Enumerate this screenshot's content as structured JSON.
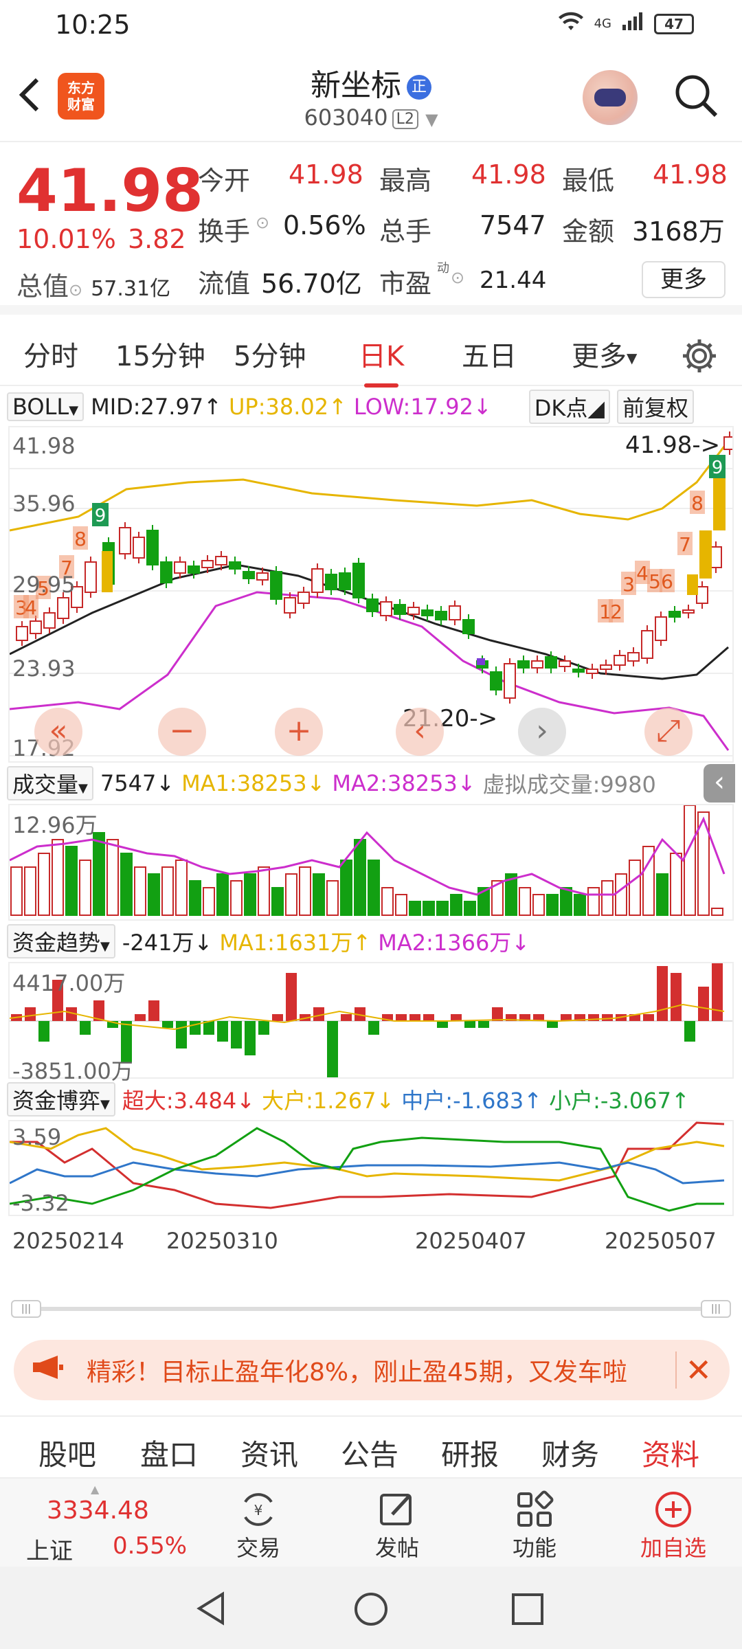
{
  "status": {
    "time": "10:25",
    "network": "4G",
    "battery": "47"
  },
  "header": {
    "name": "新坐标",
    "badge": "正",
    "code": "603040",
    "level": "L2"
  },
  "quote": {
    "price": "41.98",
    "pct": "10.01%",
    "change": "3.82",
    "total_label": "总值",
    "total_value": "57.31亿",
    "open_label": "今开",
    "open": "41.98",
    "high_label": "最高",
    "high": "41.98",
    "low_label": "最低",
    "low": "41.98",
    "turnover_label": "换手",
    "turnover": "0.56%",
    "vol_label": "总手",
    "vol": "7547",
    "amount_label": "金额",
    "amount": "3168万",
    "float_label": "流值",
    "float": "56.70亿",
    "pe_label": "市盈",
    "pe_sup": "动",
    "pe": "21.44",
    "more": "更多"
  },
  "period_tabs": [
    "分时",
    "15分钟",
    "5分钟",
    "日K",
    "五日",
    "更多"
  ],
  "boll": {
    "name": "BOLL",
    "mid": "MID:27.97",
    "up": "UP:38.02",
    "low": "LOW:17.92",
    "dk": "DK点",
    "fq": "前复权"
  },
  "kline": {
    "y_labels": [
      "41.98",
      "35.96",
      "29.95",
      "23.93",
      "17.92"
    ],
    "max_tag": "41.98->",
    "min_tag": "21.20->",
    "signals": [
      "3",
      "4",
      "5",
      "7",
      "8",
      "9",
      "12",
      "3",
      "4",
      "5",
      "6",
      "7",
      "8",
      "9"
    ]
  },
  "vol_bar": {
    "name": "成交量",
    "value": "7547",
    "ma1": "MA1:38253",
    "ma2": "MA2:38253",
    "virt": "虚拟成交量:9980",
    "max": "12.96万"
  },
  "fund_trend": {
    "name": "资金趋势",
    "value": "-241万",
    "ma1": "MA1:1631万",
    "ma2": "MA2:1366万",
    "max": "4417.00万",
    "min": "-3851.00万"
  },
  "fund_game": {
    "name": "资金博弈",
    "super": "超大:3.484",
    "big": "大户:1.267",
    "mid": "中户:-1.683",
    "small": "小户:-3.067",
    "max": "3.59",
    "min": "-3.32"
  },
  "dates": [
    "20250214",
    "20250310",
    "20250407",
    "20250507"
  ],
  "banner": {
    "text": "精彩！目标止盈年化8%，刚止盈45期，又发车啦"
  },
  "bottom_tabs": [
    "股吧",
    "盘口",
    "资讯",
    "公告",
    "研报",
    "财务",
    "资料"
  ],
  "bottom_bar": {
    "index_value": "3334.48",
    "index_name": "上证",
    "index_pct": "0.55%",
    "trade": "交易",
    "post": "发帖",
    "func": "功能",
    "add": "加自选"
  },
  "colors": {
    "up": "#e03131",
    "down": "#12a012",
    "accent": "#e03131"
  }
}
